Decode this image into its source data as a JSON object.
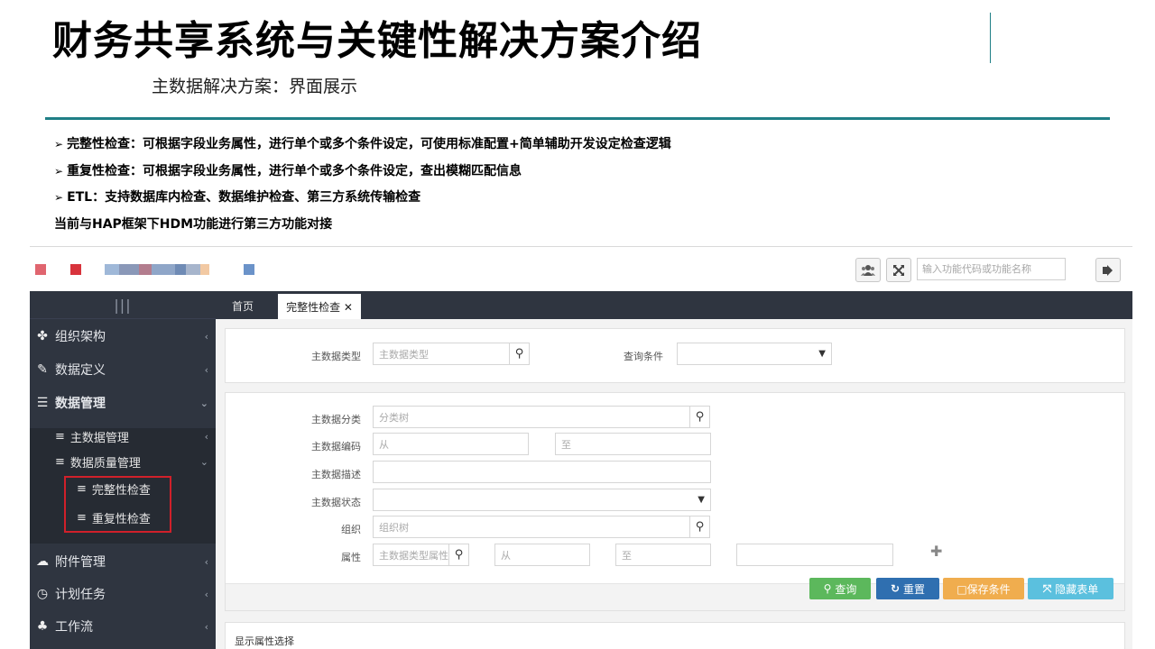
{
  "slide": {
    "title": "财务共享系统与关键性解决方案介绍",
    "subtitle": "主数据解决方案：界面展示",
    "bullets": [
      "完整性检查：可根据字段业务属性，进行单个或多个条件设定，可使用标准配置+简单辅助开发设定检查逻辑",
      "重复性检查：可根据字段业务属性，进行单个或多个条件设定，查出模糊匹配信息",
      "ETL：支持数据库内检查、数据维护检查、第三方系统传输检查"
    ],
    "bullet_marker": "➢",
    "note": "当前与HAP框架下HDM功能进行第三方功能对接"
  },
  "app": {
    "top_search": {
      "placeholder": "输入功能代码或功能名称"
    },
    "top_icons": [
      "users-icon",
      "fullscreen-icon",
      "logout-icon"
    ],
    "sidebar": {
      "collapse_icon": "|||",
      "items": [
        {
          "label": "组织架构",
          "icon": "cubes-icon",
          "chevron": "‹"
        },
        {
          "label": "数据定义",
          "icon": "pencil-icon",
          "chevron": "‹"
        },
        {
          "label": "数据管理",
          "icon": "database-icon",
          "chevron": "⌄"
        },
        {
          "label": "附件管理",
          "icon": "cloud-upload-icon",
          "chevron": "‹"
        },
        {
          "label": "计划任务",
          "icon": "clock-icon",
          "chevron": "‹"
        },
        {
          "label": "工作流",
          "icon": "sitemap-icon",
          "chevron": "‹"
        }
      ],
      "sub_items": [
        {
          "label": "主数据管理",
          "chevron": "‹"
        },
        {
          "label": "数据质量管理",
          "chevron": "⌄"
        }
      ],
      "sub_sub_items": [
        {
          "label": "完整性检查"
        },
        {
          "label": "重复性检查"
        }
      ]
    },
    "tabs": {
      "home": "首页",
      "active": "完整性检查 ✕"
    },
    "query_panel": {
      "type_label": "主数据类型",
      "type_placeholder": "主数据类型",
      "condition_label": "查询条件"
    },
    "filter_panel": {
      "category_label": "主数据分类",
      "category_placeholder": "分类树",
      "code_label": "主数据编码",
      "code_from": "从",
      "code_to": "至",
      "desc_label": "主数据描述",
      "status_label": "主数据状态",
      "org_label": "组织",
      "org_placeholder": "组织树",
      "attr_label": "属性",
      "attr_placeholder": "主数据类型属性",
      "attr_from": "从",
      "attr_to": "至"
    },
    "buttons": {
      "query": "查询",
      "reset": "重置",
      "save": "□保存条件",
      "hide": "隐藏表单"
    },
    "display_section": "显示属性选择",
    "colors": {
      "accent_teal": "#1f7f86",
      "sidebar": "#2f3540",
      "highlight": "#d0202a",
      "query_btn": "#5cb85c",
      "reset_btn": "#2f6fb0",
      "save_btn": "#f0ad4e",
      "hide_btn": "#5bc0de"
    }
  }
}
